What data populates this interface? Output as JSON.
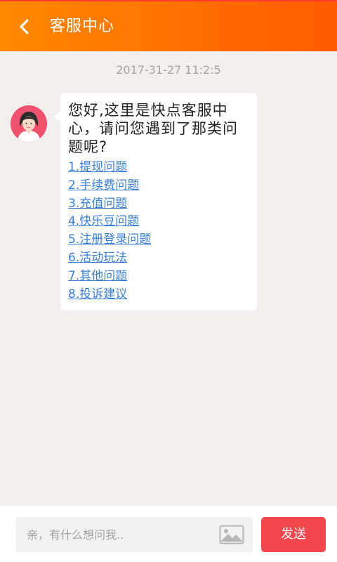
{
  "header": {
    "title": "客服中心",
    "back_icon": "chevron-left-icon",
    "gradient_start": "#ff8a00",
    "gradient_end": "#ff5a00"
  },
  "chat": {
    "timestamp": "2017-31-27 11:2:5",
    "agent_avatar_icon": "female-agent-avatar",
    "message": {
      "greeting": "您好,这里是快点客服中心，请问您遇到了那类问题呢?",
      "options": [
        "1.提现问题",
        "2.手续费问题",
        "3.充值问题",
        "4.快乐豆问题",
        "5.注册登录问题",
        "6.活动玩法",
        "7.其他问题",
        "8.投诉建议"
      ]
    }
  },
  "input_bar": {
    "placeholder": "亲，有什么想问我..",
    "value": "",
    "image_icon": "image-icon",
    "send_label": "发送",
    "send_color": "#f2474d"
  },
  "colors": {
    "background": "#f3efee",
    "link": "#3a7fd6"
  }
}
